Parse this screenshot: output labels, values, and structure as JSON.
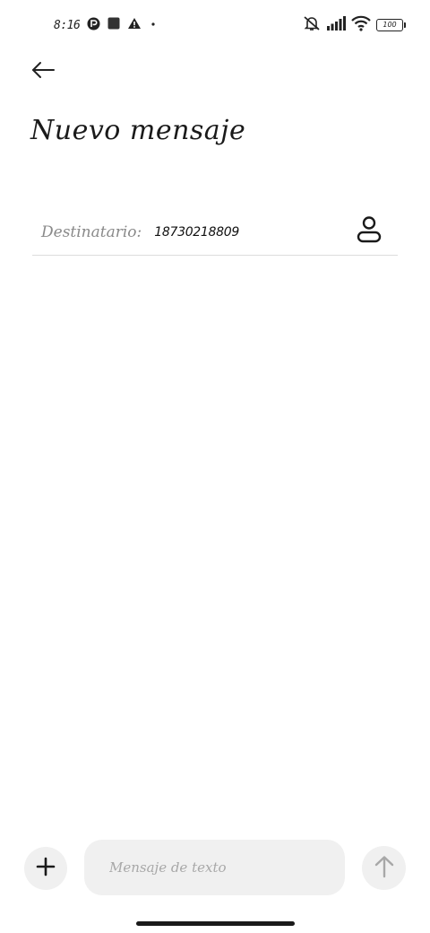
{
  "status_bar": {
    "time": "8:16",
    "battery_level": "100",
    "notification_icons": [
      "app-notification-icon",
      "square-notification-icon",
      "warning-icon",
      "dot-icon"
    ],
    "system_icons": [
      "mute-icon",
      "signal-icon",
      "wifi-icon",
      "battery-icon"
    ]
  },
  "header": {
    "back_icon": "arrow-left-icon",
    "title": "Nuevo mensaje"
  },
  "recipient": {
    "label": "Destinatario:",
    "value": "18730218809",
    "contact_icon": "person-icon"
  },
  "composer": {
    "add_icon": "plus-icon",
    "placeholder": "Mensaje de texto",
    "send_icon": "arrow-up-icon"
  },
  "colors": {
    "background": "#ffffff",
    "text": "#111111",
    "muted_text": "#8a8a8a",
    "input_background": "#f0f0f0",
    "divider": "#dddddd",
    "disabled_icon": "#a8a8a8"
  }
}
